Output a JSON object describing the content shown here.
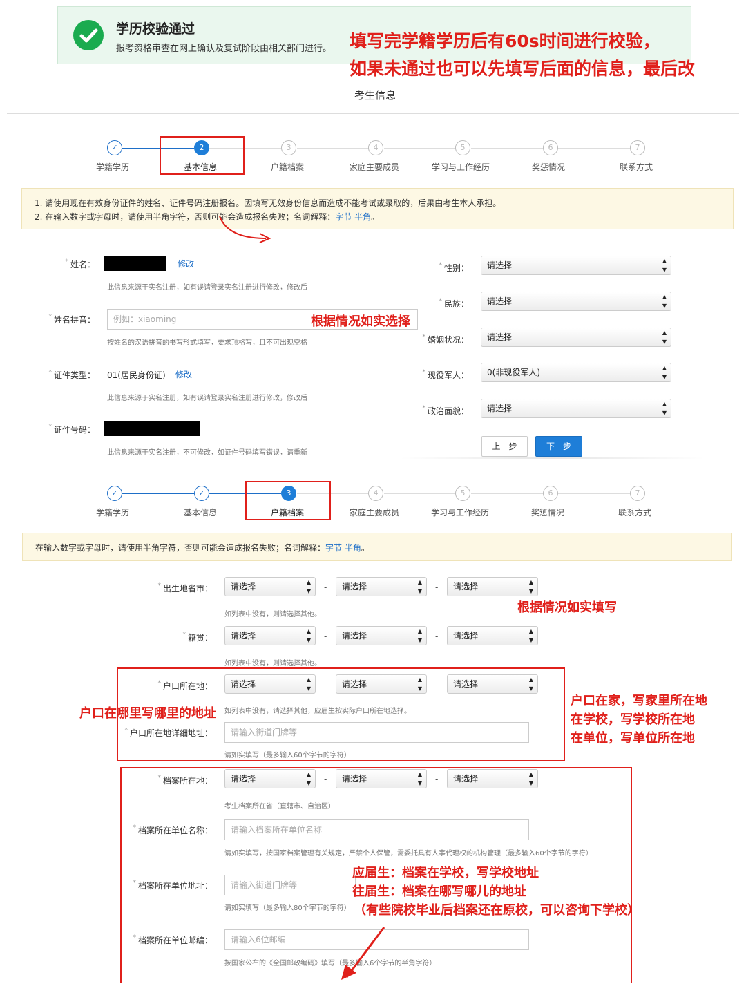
{
  "success": {
    "title": "学历校验通过",
    "subtitle": "报考资格审查在网上确认及复试阶段由相关部门进行。"
  },
  "annotations": {
    "top_line1": "填写完学籍学历后有60s时间进行校验，",
    "top_line2": "如果未通过也可以先填写后面的信息，最后改",
    "select_truthfully": "根据情况如实选择",
    "fill_truthfully": "根据情况如实填写",
    "hukou_left": "户口在哪里写哪里的地址",
    "hukou_right1": "户口在家，写家里所在地",
    "hukou_right2": "在学校，写学校所在地",
    "hukou_right3": "在单位，写单位所在地",
    "archive1": "应届生：档案在学校，写学校地址",
    "archive2": "往届生：档案在哪写哪儿的地址",
    "archive3": "（有些院校毕业后档案还在原校，可以咨询下学校）"
  },
  "section_title": "考生信息",
  "steps": [
    {
      "num": "1",
      "label": "学籍学历"
    },
    {
      "num": "2",
      "label": "基本信息"
    },
    {
      "num": "3",
      "label": "户籍档案"
    },
    {
      "num": "4",
      "label": "家庭主要成员"
    },
    {
      "num": "5",
      "label": "学习与工作经历"
    },
    {
      "num": "6",
      "label": "奖惩情况"
    },
    {
      "num": "7",
      "label": "联系方式"
    }
  ],
  "notice1": {
    "line1": "1. 请使用现在有效身份证件的姓名、证件号码注册报名。因填写无效身份信息而造成不能考试或录取的，后果由考生本人承担。",
    "line2_prefix": "2. 在输入数字或字母时，请使用半角字符，否则可能会造成报名失败；名词解释：",
    "link1": "字节",
    "link2": "半角",
    "end": "。"
  },
  "notice2": {
    "prefix": "在输入数字或字母时，请使用半角字符，否则可能会造成报名失败；名词解释：",
    "link1": "字节",
    "link2": "半角",
    "end": "。"
  },
  "basic": {
    "name_label": "姓名：",
    "modify": "修改",
    "name_hint": "此信息来源于实名注册，如有误请登录实名注册进行修改，修改后",
    "pinyin_label": "姓名拼音：",
    "pinyin_placeholder": "例如：xiaoming",
    "pinyin_hint": "按姓名的汉语拼音的书写形式填写，要求顶格写，且不可出现空格",
    "id_type_label": "证件类型：",
    "id_type_value": "01(居民身份证)",
    "id_type_hint": "此信息来源于实名注册，如有误请登录实名注册进行修改，修改后",
    "id_no_label": "证件号码：",
    "id_no_hint": "此信息来源于实名注册，不可修改，如证件号码填写错误，请重新",
    "gender_label": "性别：",
    "gender_value": "请选择",
    "ethnic_label": "民族：",
    "ethnic_value": "请选择",
    "marital_label": "婚姻状况：",
    "marital_value": "请选择",
    "military_label": "现役军人：",
    "military_value": "0(非现役军人)",
    "political_label": "政治面貌：",
    "political_value": "请选择",
    "prev_button": "上一步",
    "next_button": "下一步"
  },
  "hukou": {
    "select_placeholder": "请选择",
    "birthplace_label": "出生地省市：",
    "birthplace_hint": "如列表中没有，则请选择其他。",
    "native_label": "籍贯：",
    "native_hint": "如列表中没有，则请选择其他。",
    "hukou_label": "户口所在地：",
    "hukou_hint": "如列表中没有，请选择其他，应届生按实际户口所在地选择。",
    "hukou_detail_label": "户口所在地详细地址：",
    "hukou_detail_placeholder": "请输入街道门牌等",
    "hukou_detail_hint": "请如实填写（最多输入60个字节的字符）",
    "archive_label": "档案所在地：",
    "archive_hint": "考生档案所在省（直辖市、自治区）",
    "archive_unit_label": "档案所在单位名称：",
    "archive_unit_placeholder": "请输入档案所在单位名称",
    "archive_unit_hint": "请如实填写，按国家档案管理有关规定，严禁个人保管，需委托具有人事代理权的机构管理（最多输入60个字节的字符）",
    "archive_addr_label": "档案所在单位地址：",
    "archive_addr_placeholder": "请输入街道门牌等",
    "archive_addr_hint": "请如实填写（最多输入80个字节的字符）",
    "archive_zip_label": "档案所在单位邮编：",
    "archive_zip_placeholder": "请输入6位邮编",
    "archive_zip_hint": "按国家公布的《全国邮政编码》填写（最多输入6个字节的半角字符）"
  }
}
